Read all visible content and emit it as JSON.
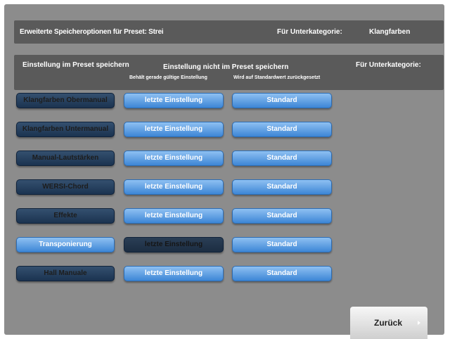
{
  "header": {
    "title": "Erweiterte Speicheroptionen für Preset: Strei",
    "subcategory_label": "Für Unterkategorie:",
    "subcategory_value": "Klangfarben"
  },
  "columns": {
    "save_in_preset": "Einstellung im Preset speichern",
    "not_save_in_preset": "Einstellung nicht im Preset speichern",
    "keep_current_hint": "Behält gerade gültige Einstellung",
    "reset_default_hint": "Wird auf Standardwert zurückgesetzt",
    "subcategory_label": "Für Unterkategorie:"
  },
  "rows": [
    {
      "category": "Klangfarben Obermanual",
      "keep_label": "letzte Einstellung",
      "default_label": "Standard",
      "selected": "preset"
    },
    {
      "category": "Klangfarben Untermanual",
      "keep_label": "letzte Einstellung",
      "default_label": "Standard",
      "selected": "preset"
    },
    {
      "category": "Manual-Lautstärken",
      "keep_label": "letzte Einstellung",
      "default_label": "Standard",
      "selected": "preset"
    },
    {
      "category": "WERSI-Chord",
      "keep_label": "letzte Einstellung",
      "default_label": "Standard",
      "selected": "preset"
    },
    {
      "category": "Effekte",
      "keep_label": "letzte Einstellung",
      "default_label": "Standard",
      "selected": "preset"
    },
    {
      "category": "Transponierung",
      "keep_label": "letzte Einstellung",
      "default_label": "Standard",
      "selected": "keep"
    },
    {
      "category": "Hall Manuale",
      "keep_label": "letzte Einstellung",
      "default_label": "Standard",
      "selected": "preset"
    }
  ],
  "footer": {
    "back_label": "Zurück"
  },
  "colors": {
    "panel": "#8c8c8c",
    "bar": "#5a5a5a",
    "button_dark": "#1b3350",
    "button_light": "#3d86d6"
  }
}
